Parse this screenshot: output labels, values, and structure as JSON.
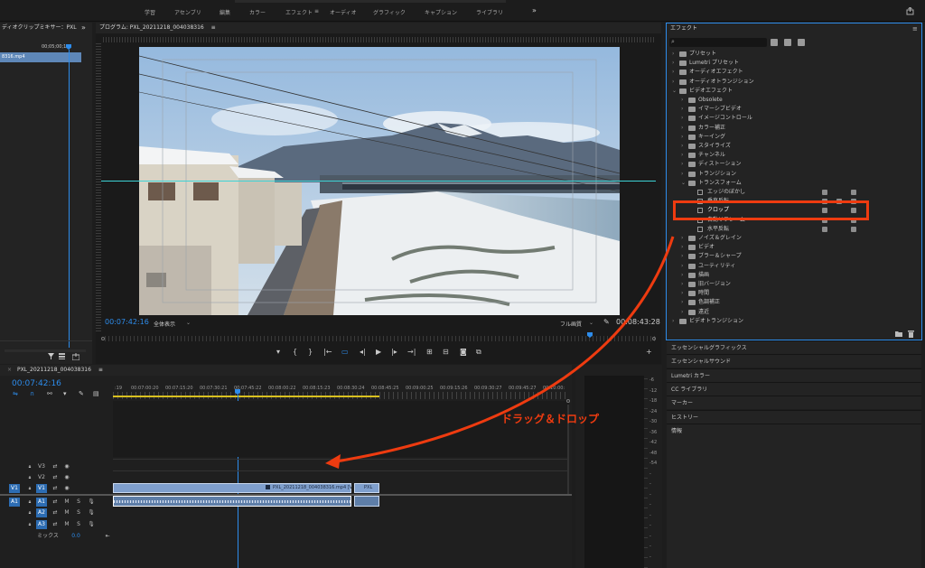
{
  "workspaces": [
    "学習",
    "アセンブリ",
    "編集",
    "カラー",
    "エフェクト",
    "オーディオ",
    "グラフィック",
    "キャプション",
    "ライブラリ"
  ],
  "workspace_active": "エフェクト",
  "more_label": "»",
  "audio_mixer": {
    "title": "ディオクリップミキサー：PXL",
    "timecode": "00;05;00;14",
    "clip_name": "8316.mp4"
  },
  "program": {
    "title": "プログラム: PXL_20211218_004038316",
    "timecode": "00:07:42:16",
    "zoom": "全体表示",
    "quality": "フル画質",
    "duration": "00:08:43:28"
  },
  "effects": {
    "title": "エフェクト",
    "search_placeholder": "",
    "rows": [
      {
        "label": "プリセット",
        "level": 0,
        "kind": "folder",
        "chev": "›"
      },
      {
        "label": "Lumetri プリセット",
        "level": 0,
        "kind": "folder",
        "chev": "›"
      },
      {
        "label": "オーディオエフェクト",
        "level": 0,
        "kind": "folder",
        "chev": "›"
      },
      {
        "label": "オーディオトランジション",
        "level": 0,
        "kind": "folder",
        "chev": "›"
      },
      {
        "label": "ビデオエフェクト",
        "level": 0,
        "kind": "folder",
        "chev": "⌄"
      },
      {
        "label": "Obsolete",
        "level": 1,
        "kind": "folder",
        "chev": "›"
      },
      {
        "label": "イマーシブビデオ",
        "level": 1,
        "kind": "folder",
        "chev": "›"
      },
      {
        "label": "イメージコントロール",
        "level": 1,
        "kind": "folder",
        "chev": "›"
      },
      {
        "label": "カラー補正",
        "level": 1,
        "kind": "folder",
        "chev": "›"
      },
      {
        "label": "キーイング",
        "level": 1,
        "kind": "folder",
        "chev": "›"
      },
      {
        "label": "スタイライズ",
        "level": 1,
        "kind": "folder",
        "chev": "›"
      },
      {
        "label": "チャンネル",
        "level": 1,
        "kind": "folder",
        "chev": "›"
      },
      {
        "label": "ディストーション",
        "level": 1,
        "kind": "folder",
        "chev": "›"
      },
      {
        "label": "トランジション",
        "level": 1,
        "kind": "folder",
        "chev": "›"
      },
      {
        "label": "トランスフォーム",
        "level": 1,
        "kind": "folder",
        "chev": "⌄"
      },
      {
        "label": "エッジのぼかし",
        "level": 2,
        "kind": "effect",
        "badges": 2
      },
      {
        "label": "垂直反転",
        "level": 2,
        "kind": "effect",
        "badges": 3
      },
      {
        "label": "クロップ",
        "level": 2,
        "kind": "effect",
        "badges": 2
      },
      {
        "label": "自動リフレーム",
        "level": 2,
        "kind": "effect",
        "badges": 2
      },
      {
        "label": "水平反転",
        "level": 2,
        "kind": "effect",
        "badges": 2
      },
      {
        "label": "ノイズ＆グレイン",
        "level": 1,
        "kind": "folder",
        "chev": "›"
      },
      {
        "label": "ビデオ",
        "level": 1,
        "kind": "folder",
        "chev": "›"
      },
      {
        "label": "ブラー＆シャープ",
        "level": 1,
        "kind": "folder",
        "chev": "›"
      },
      {
        "label": "ユーティリティ",
        "level": 1,
        "kind": "folder",
        "chev": "›"
      },
      {
        "label": "描画",
        "level": 1,
        "kind": "folder",
        "chev": "›"
      },
      {
        "label": "旧バージョン",
        "level": 1,
        "kind": "folder",
        "chev": "›"
      },
      {
        "label": "時間",
        "level": 1,
        "kind": "folder",
        "chev": "›"
      },
      {
        "label": "色調補正",
        "level": 1,
        "kind": "folder",
        "chev": "›"
      },
      {
        "label": "遠近",
        "level": 1,
        "kind": "folder",
        "chev": "›"
      },
      {
        "label": "ビデオトランジション",
        "level": 0,
        "kind": "folder",
        "chev": "›"
      }
    ],
    "highlighted": "クロップ"
  },
  "panel_stack": [
    "エッセンシャルグラフィックス",
    "エッセンシャルサウンド",
    "Lumetri カラー",
    "CC ライブラリ",
    "マーカー",
    "ヒストリー",
    "情報"
  ],
  "timeline": {
    "title": "PXL_20211218_004038316",
    "timecode": "00:07:42:16",
    "ruler": [
      "00:07:00:20",
      "00:07:15:20",
      "00:07:30:21",
      "00:07:45:22",
      "00:08:00:22",
      "00:08:15:23",
      "00:08:30:24",
      "00:08:45:25",
      "00:09:00:25",
      "00:09:15:26",
      "00:09:30:27",
      "00:09:45:27",
      "00:10:00:"
    ],
    "ruler_first": ":19",
    "tracks": [
      {
        "name": "V3",
        "kind": "video"
      },
      {
        "name": "V2",
        "kind": "video"
      },
      {
        "name": "V1",
        "kind": "video",
        "source": "V1"
      },
      {
        "name": "A1",
        "kind": "audio",
        "source": "A1"
      },
      {
        "name": "A2",
        "kind": "audio"
      },
      {
        "name": "A3",
        "kind": "audio"
      }
    ],
    "mix_label": "ミックス",
    "mix_value": "0.0",
    "clip_label": "PXL_20211218_004038316.mp4 [V",
    "clip2_label": "PXL"
  },
  "annotation": {
    "text": "ドラッグ＆ドロップ",
    "color": "#ee3b10"
  },
  "meter_labels": [
    "-6",
    "-12",
    "-18",
    "-24",
    "-30",
    "-36",
    "-42",
    "-48",
    "-54",
    "-",
    "-",
    "-",
    "-",
    "-",
    "-",
    "-",
    "-",
    "-"
  ],
  "track_buttons": {
    "mute": "M",
    "solo": "S"
  }
}
